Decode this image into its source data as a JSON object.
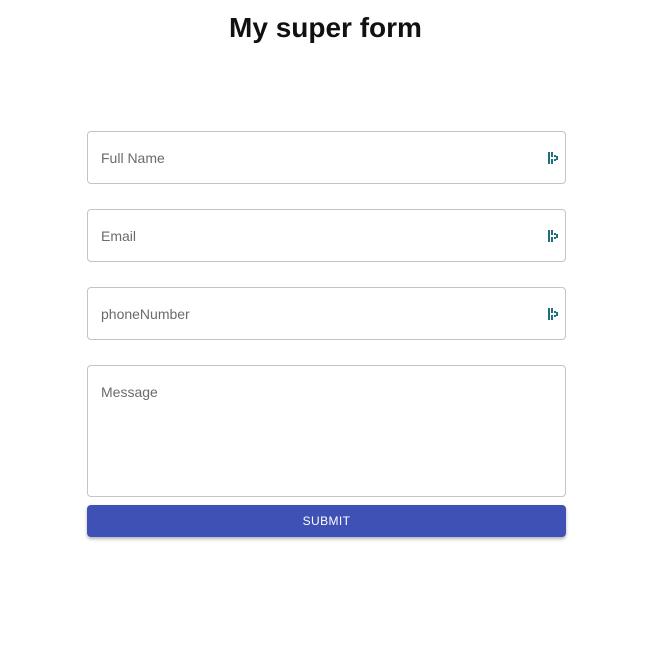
{
  "page": {
    "title": "My super form"
  },
  "form": {
    "fields": [
      {
        "placeholder": "Full Name",
        "icon": "password-manager-icon"
      },
      {
        "placeholder": "Email",
        "icon": "password-manager-icon"
      },
      {
        "placeholder": "phoneNumber",
        "icon": "password-manager-icon"
      },
      {
        "placeholder": "Message"
      }
    ],
    "submit_label": "SUBMIT"
  },
  "colors": {
    "accent": "#3f51b5",
    "icon": "#1f6f7a",
    "border": "#c4c4c4"
  }
}
